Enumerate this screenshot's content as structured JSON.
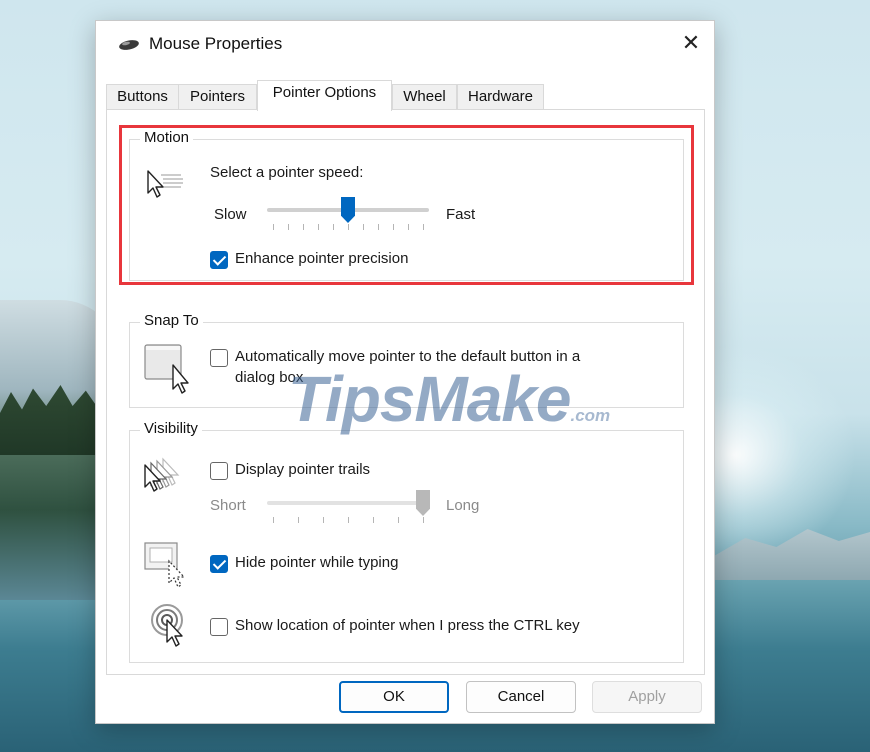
{
  "window": {
    "title": "Mouse Properties",
    "close_glyph": "✕"
  },
  "tabs": [
    {
      "label": "Buttons",
      "active": false
    },
    {
      "label": "Pointers",
      "active": false
    },
    {
      "label": "Pointer Options",
      "active": true
    },
    {
      "label": "Wheel",
      "active": false
    },
    {
      "label": "Hardware",
      "active": false
    }
  ],
  "motion": {
    "legend": "Motion",
    "prompt": "Select a pointer speed:",
    "slow_label": "Slow",
    "fast_label": "Fast",
    "speed_level": 0.5,
    "enhance_label": "Enhance pointer precision",
    "enhance_checked": true
  },
  "snap_to": {
    "legend": "Snap To",
    "auto_move_label_line1": "Automatically move pointer to the default button in a",
    "auto_move_label_line2": "dialog box",
    "auto_move_checked": false
  },
  "visibility": {
    "legend": "Visibility",
    "trails_label": "Display pointer trails",
    "trails_checked": false,
    "short_label": "Short",
    "long_label": "Long",
    "trail_length_level": 1.0,
    "hide_label": "Hide pointer while typing",
    "hide_checked": true,
    "show_location_label": "Show location of pointer when I press the CTRL key",
    "show_location_checked": false
  },
  "buttons": {
    "ok": "OK",
    "cancel": "Cancel",
    "apply": "Apply"
  },
  "watermark": {
    "text": "TipsMake",
    "domain": ".com"
  },
  "colors": {
    "accent": "#0067c0",
    "highlight": "#e8363c",
    "disabled_thumb": "#b8b8b8"
  },
  "icons": [
    "mouse-icon",
    "close-icon",
    "pointer-speed-icon",
    "snap-to-icon",
    "pointer-trails-icon",
    "hide-pointer-icon",
    "show-location-icon"
  ]
}
